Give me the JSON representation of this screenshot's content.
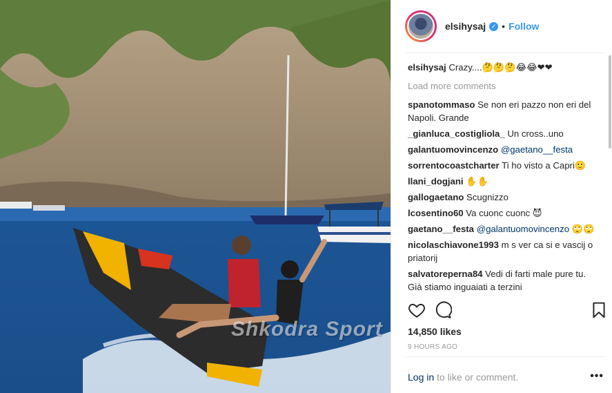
{
  "post": {
    "username": "elsihysaj",
    "follow_label": "Follow",
    "separator": "•",
    "caption_user": "elsihysaj",
    "caption_text": "Crazy....🤔🤔🤔😂😂❤❤",
    "load_more": "Load more comments",
    "comments": [
      {
        "user": "spanotommaso",
        "text": "Se non eri pazzo non eri del Napoli. Grande"
      },
      {
        "user": "_gianluca_costigliola_",
        "text": "Un cross..uno"
      },
      {
        "user": "galantuomovincenzo",
        "mention": "@gaetano__festa",
        "text": ""
      },
      {
        "user": "sorrentocoastcharter",
        "text": "Ti ho visto a Capri🙂"
      },
      {
        "user": "llani_dogjani",
        "text": "✋✋"
      },
      {
        "user": "gallogaetano",
        "text": "Scugnizzo"
      },
      {
        "user": "lcosentino60",
        "text": "Va cuonc cuonc 😈"
      },
      {
        "user": "gaetano__festa",
        "mention": "@galantuomovincenzo",
        "text": "🙄🙄"
      },
      {
        "user": "nicolaschiavone1993",
        "text": "m s ver ca si e vascij o priatorij"
      },
      {
        "user": "salvatoreperna84",
        "text": "Vedi di farti male pure tu. Già stiamo inguaiati a terzini"
      }
    ],
    "likes": "14,850 likes",
    "timestamp": "9 HOURS AGO",
    "login_link": "Log in",
    "login_text": " to like or comment.",
    "more_label": "•••",
    "watermark": "Shkodra Sport"
  },
  "icons": {
    "verified": "verified-badge-icon",
    "like": "heart-icon",
    "comment": "comment-bubble-icon",
    "save": "bookmark-icon",
    "more": "more-options-icon"
  },
  "colors": {
    "accent": "#3897f0",
    "link": "#003569",
    "muted": "#999999"
  }
}
